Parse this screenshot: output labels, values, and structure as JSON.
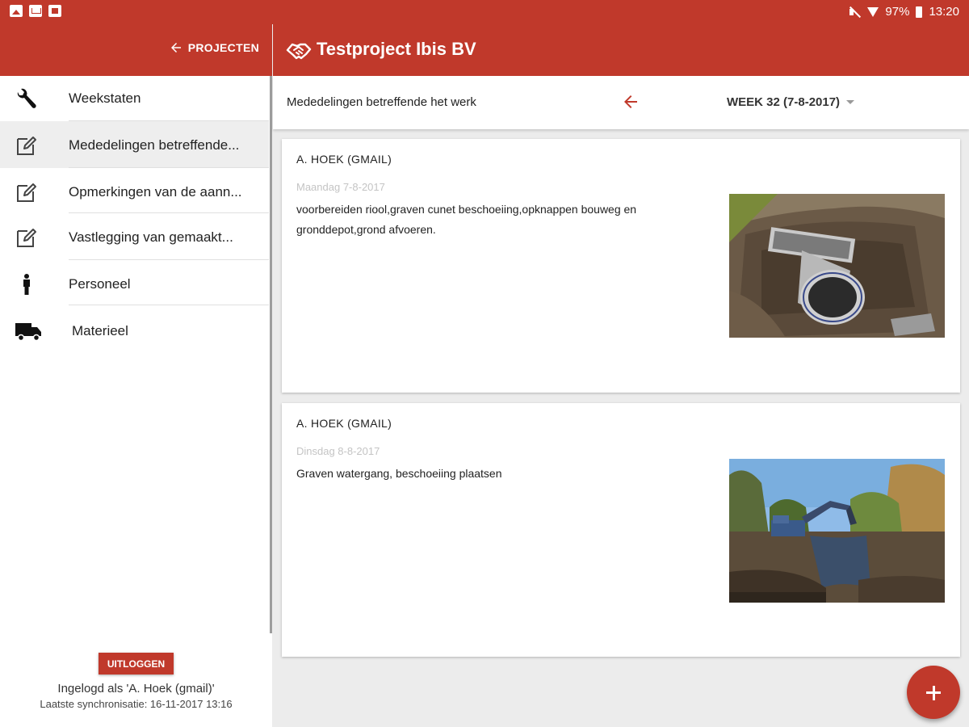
{
  "status_bar": {
    "left_icons": [
      "image-icon",
      "mail-icon",
      "flag-icon"
    ],
    "battery": "97%",
    "time": "13:20"
  },
  "sidebar_header": {
    "back_label": "PROJECTEN"
  },
  "header": {
    "title": "Testproject Ibis BV",
    "icon": "handshake-icon"
  },
  "sidebar": {
    "items": [
      {
        "label": "Weekstaten",
        "icon": "wrench-icon"
      },
      {
        "label": "Mededelingen betreffende...",
        "icon": "edit-icon"
      },
      {
        "label": "Opmerkingen van de aann...",
        "icon": "edit-icon"
      },
      {
        "label": "Vastlegging van gemaakt...",
        "icon": "edit-icon"
      },
      {
        "label": "Personeel",
        "icon": "person-icon"
      },
      {
        "label": "Materieel",
        "icon": "truck-icon"
      }
    ],
    "active_index": 1,
    "logout_label": "UITLOGGEN",
    "logged_in_as": "Ingelogd als 'A. Hoek (gmail)'",
    "last_sync": "Laatste synchronisatie: 16-11-2017 13:16"
  },
  "subheader": {
    "title": "Mededelingen betreffende het werk",
    "week": "WEEK 32 (7-8-2017)"
  },
  "cards": [
    {
      "author": "A. HOEK (GMAIL)",
      "date": "Maandag 7-8-2017",
      "text": "voorbereiden riool,graven cunet beschoeiing,opknappen bouweg en gronddepot,grond afvoeren."
    },
    {
      "author": "A. HOEK (GMAIL)",
      "date": "Dinsdag 8-8-2017",
      "text": "Graven watergang, beschoeiing plaatsen"
    }
  ],
  "colors": {
    "primary": "#c0392b",
    "active_bg": "#eeeeee",
    "date_text": "#c4c4c4"
  }
}
